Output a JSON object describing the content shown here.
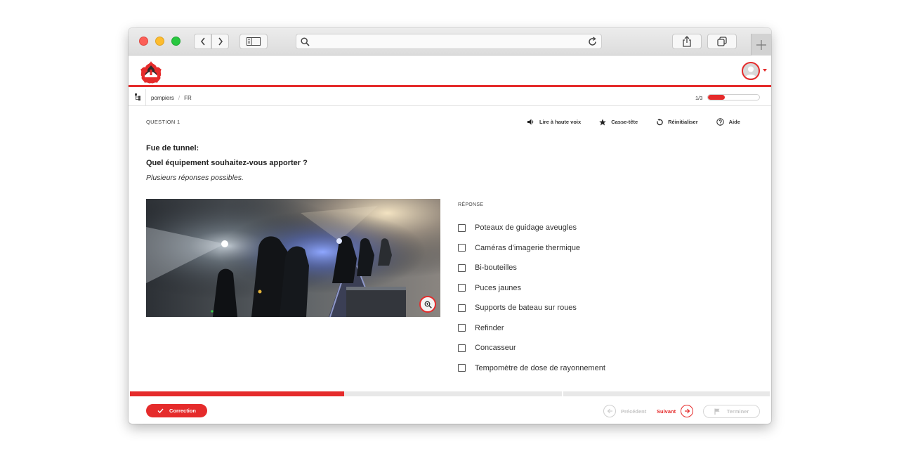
{
  "breadcrumb": [
    "pompiers",
    "FR"
  ],
  "progress": {
    "label": "1/3",
    "fraction": 0.33
  },
  "question": {
    "label": "QUESTION 1",
    "title": "Fue de tunnel:",
    "text": "Quel équipement souhaitez-vous apporter ?",
    "hint": "Plusieurs réponses possibles."
  },
  "tools": {
    "read_aloud": "Lire à haute voix",
    "puzzle": "Casse-tête",
    "reset": "Réinitialiser",
    "help": "Aide"
  },
  "answers": {
    "label": "RÉPONSE",
    "options": [
      "Poteaux de guidage aveugles",
      "Caméras d'imagerie thermique",
      "Bi-bouteilles",
      "Puces jaunes",
      "Supports de bateau sur roues",
      "Refinder",
      "Concasseur",
      "Tempomètre de dose de rayonnement"
    ]
  },
  "footer": {
    "correction": "Correction",
    "previous": "Précédent",
    "next": "Suivant",
    "finish": "Terminer"
  },
  "section_progress": {
    "fraction": 0.335
  },
  "colors": {
    "accent": "#e52b2b"
  }
}
